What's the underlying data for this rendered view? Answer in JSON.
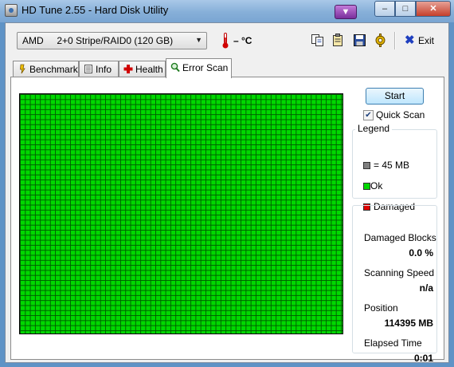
{
  "window": {
    "title": "HD Tune 2.55 - Hard Disk Utility",
    "controls": {
      "minimize": "–",
      "maximize": "□",
      "close": "✕"
    }
  },
  "toolbar": {
    "drive": "AMD     2+0 Stripe/RAID0 (120 GB)",
    "temperature": "– °C",
    "exit_label": "Exit",
    "icons": [
      "copy-icon",
      "copy-text-icon",
      "save-icon",
      "options-icon"
    ]
  },
  "tabs": [
    {
      "label": "Benchmark",
      "icon": "benchmark-icon"
    },
    {
      "label": "Info",
      "icon": "info-icon"
    },
    {
      "label": "Health",
      "icon": "health-icon"
    },
    {
      "label": "Error Scan",
      "icon": "search-icon",
      "active": true
    }
  ],
  "scan": {
    "start_label": "Start",
    "quick_scan_label": "Quick Scan",
    "quick_scan_checked": true,
    "block_state": "ok",
    "colors": {
      "ok": "#00d800",
      "damaged": "#e00000",
      "unit": "#808080"
    }
  },
  "legend": {
    "title": "Legend",
    "items": [
      {
        "label": "= 45 MB",
        "color": "#808080"
      },
      {
        "label": "Ok",
        "color": "#00d800"
      },
      {
        "label": "Damaged",
        "color": "#e00000"
      }
    ]
  },
  "stats": {
    "damaged_blocks_label": "Damaged Blocks",
    "damaged_blocks_value": "0.0 %",
    "scanning_speed_label": "Scanning Speed",
    "scanning_speed_value": "n/a",
    "position_label": "Position",
    "position_value": "114395 MB",
    "elapsed_label": "Elapsed Time",
    "elapsed_value": "0:01"
  }
}
